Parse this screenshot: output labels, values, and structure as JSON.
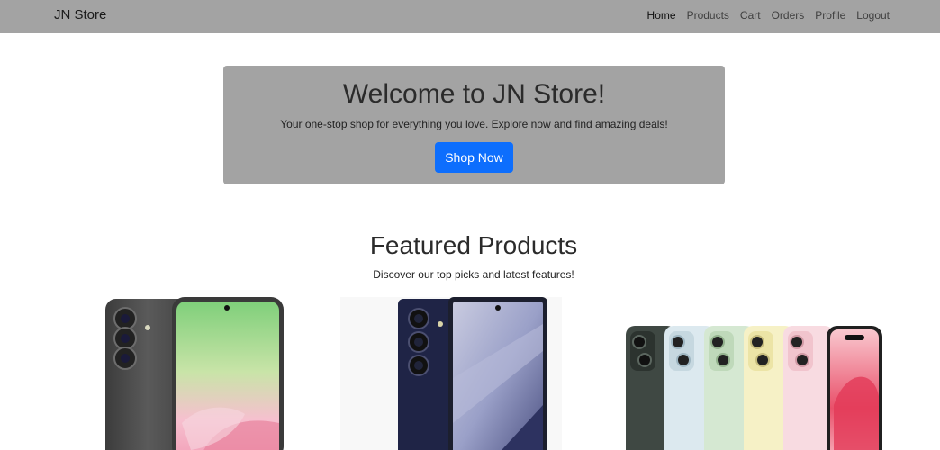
{
  "navbar": {
    "brand": "JN Store",
    "links": [
      {
        "label": "Home"
      },
      {
        "label": "Products"
      },
      {
        "label": "Cart"
      },
      {
        "label": "Orders"
      },
      {
        "label": "Profile"
      },
      {
        "label": "Logout"
      }
    ]
  },
  "hero": {
    "title": "Welcome to JN Store!",
    "subtitle": "Your one-stop shop for everything you love. Explore now and find amazing deals!",
    "button": "Shop Now",
    "button_color": "#0d6efd"
  },
  "featured": {
    "title": "Featured Products",
    "subtitle": "Discover our top picks and latest features!"
  },
  "products": [
    {
      "image": "phone-image-gray-green"
    },
    {
      "image": "foldable-phone-image-navy"
    },
    {
      "image": "phone-lineup-image-pastel"
    }
  ],
  "colors": {
    "navbar_bg": "#a3a3a3",
    "hero_bg": "#a3a3a3",
    "accent": "#0d6efd"
  }
}
